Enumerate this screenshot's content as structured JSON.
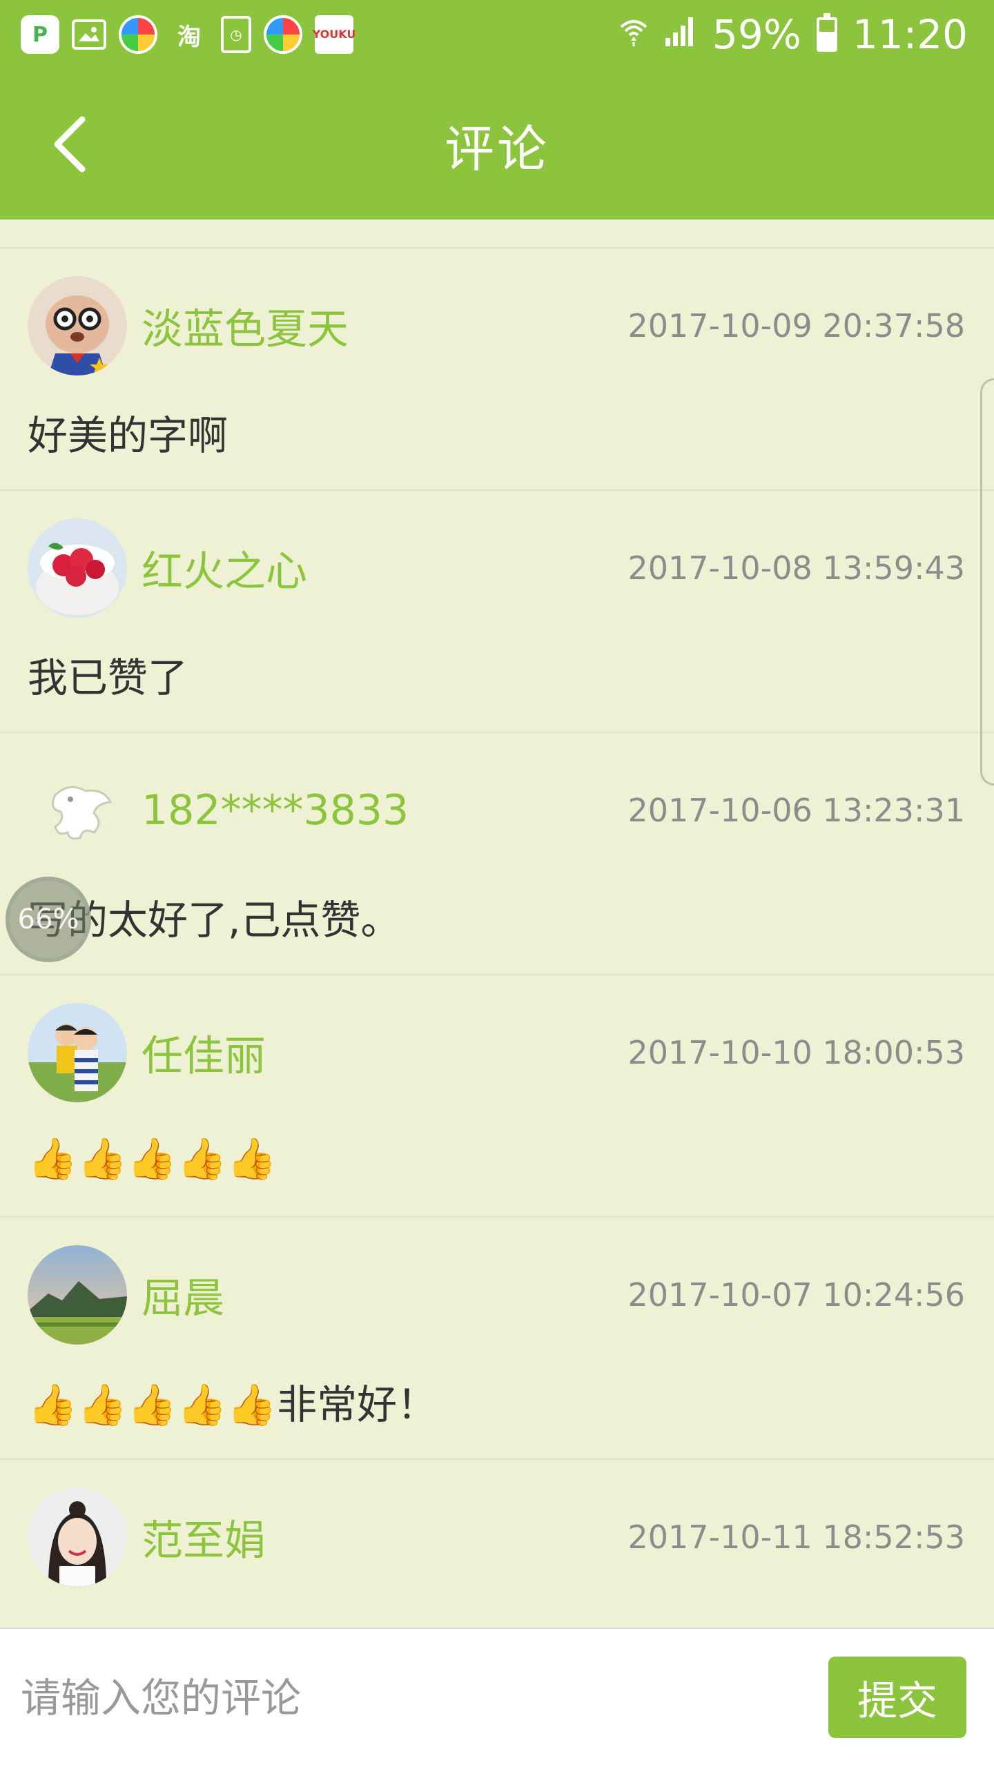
{
  "status_bar": {
    "apps": [
      {
        "icon": "parking-app-icon",
        "glyph": "P"
      },
      {
        "icon": "gallery-app-icon",
        "glyph": ""
      },
      {
        "icon": "ball-app-icon",
        "glyph": ""
      },
      {
        "icon": "taobao-app-icon",
        "glyph": "淘"
      },
      {
        "icon": "clock-app-icon",
        "glyph": "◷"
      },
      {
        "icon": "ball-app-icon-2",
        "glyph": ""
      },
      {
        "icon": "youku-app-icon",
        "glyph": "YOUKU"
      }
    ],
    "battery": "59%",
    "time": "11:20"
  },
  "header": {
    "title": "评论",
    "back_icon": "chevron-left-icon"
  },
  "colors": {
    "brand": "#8cc43e",
    "background": "#eff1d4",
    "username": "#8cc43e",
    "timestamp": "#8c8c8c"
  },
  "comments": [
    {
      "user": "淡蓝色夏天",
      "time": "2017-10-09 20:37:58",
      "text": "好美的字啊",
      "avatar": "cartoon-dog-avatar"
    },
    {
      "user": "红火之心",
      "time": "2017-10-08 13:59:43",
      "text": "我已赞了",
      "avatar": "raspberries-avatar"
    },
    {
      "user": "182****3833",
      "time": "2017-10-06 13:23:31",
      "text": "写的太好了,己点赞。",
      "avatar": "dragon-sketch-avatar"
    },
    {
      "user": "任佳丽",
      "time": "2017-10-10 18:00:53",
      "text": "👍👍👍👍👍",
      "avatar": "children-avatar"
    },
    {
      "user": "屈晨",
      "time": "2017-10-07 10:24:56",
      "text": "👍👍👍👍👍非常好！",
      "avatar": "landscape-avatar"
    },
    {
      "user": "范至娟",
      "time": "2017-10-11 18:52:53",
      "text": "",
      "avatar": "girl-portrait-avatar"
    }
  ],
  "float_bubble": "66%",
  "input": {
    "placeholder": "请输入您的评论",
    "value": "",
    "submit_label": "提交"
  }
}
